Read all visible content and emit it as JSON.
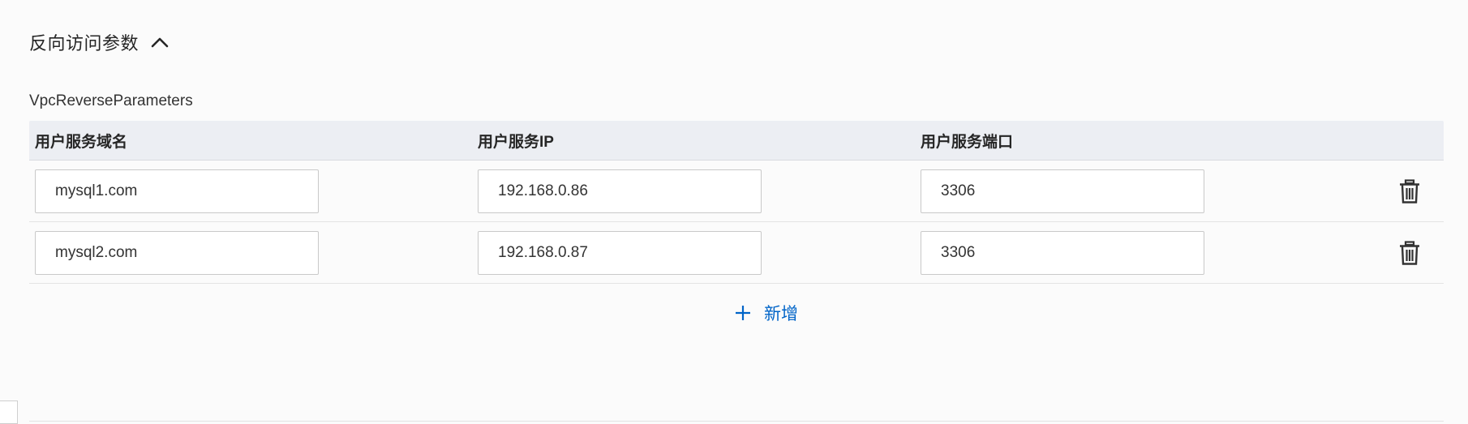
{
  "section": {
    "title": "反向访问参数",
    "icon": "chevron-up-icon"
  },
  "field": {
    "label": "VpcReverseParameters"
  },
  "table": {
    "headers": [
      "用户服务域名",
      "用户服务IP",
      "用户服务端口"
    ],
    "rows": [
      {
        "domain": "mysql1.com",
        "ip": "192.168.0.86",
        "port": "3306"
      },
      {
        "domain": "mysql2.com",
        "ip": "192.168.0.87",
        "port": "3306"
      }
    ],
    "delete_icon": "trash-icon"
  },
  "add": {
    "label": "新增",
    "icon": "plus-icon"
  },
  "colors": {
    "accent": "#0064c8",
    "header_bg": "#eceef3",
    "page_bg": "#fbfbfb"
  }
}
